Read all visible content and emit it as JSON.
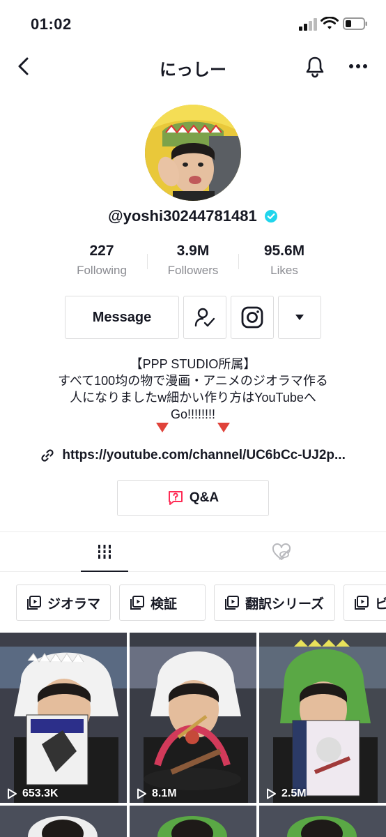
{
  "status": {
    "time": "01:02"
  },
  "nav": {
    "title": "にっしー"
  },
  "profile": {
    "handle": "@yoshi30244781481",
    "stats": [
      {
        "num": "227",
        "label": "Following"
      },
      {
        "num": "3.9M",
        "label": "Followers"
      },
      {
        "num": "95.6M",
        "label": "Likes"
      }
    ]
  },
  "actions": {
    "message": "Message"
  },
  "bio": {
    "line1": "【PPP STUDIO所属】",
    "line2": "すべて100均の物で漫画・アニメのジオラマ作る",
    "line3": "人になりましたw細かい作り方はYouTubeへ",
    "line4": "Go!!!!!!!!"
  },
  "link": {
    "url": "https://youtube.com/channel/UC6bCc-UJ2p..."
  },
  "qa": {
    "label": "Q&A"
  },
  "playlists": [
    {
      "label": "ジオラマ"
    },
    {
      "label": "検証"
    },
    {
      "label": "翻訳シリーズ"
    },
    {
      "label": "ビ"
    }
  ],
  "videos": [
    {
      "views": "653.3K"
    },
    {
      "views": "8.1M"
    },
    {
      "views": "2.5M"
    }
  ],
  "colors": {
    "verified": "#20d5ec",
    "accent": "#fe2c55",
    "arrow": "#e0433a"
  }
}
